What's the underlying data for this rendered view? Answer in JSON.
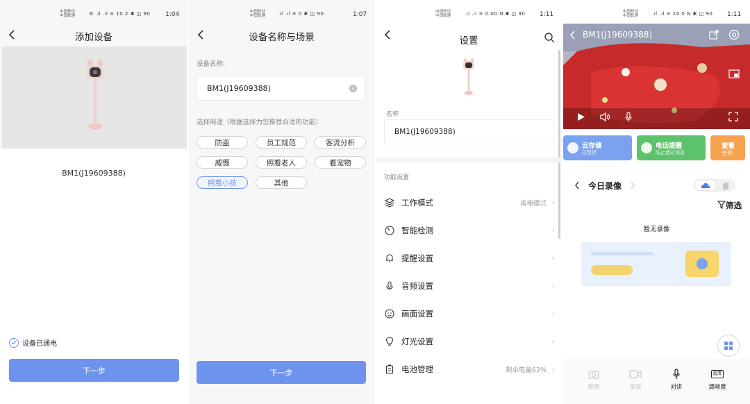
{
  "colors": {
    "primary": "#6e93ef",
    "primary_text": "#ffffff",
    "cloud_card": "#7aa2ef",
    "phone_card": "#5cc26b",
    "more_card": "#f7a24e",
    "video_bg": "#c72a2a"
  },
  "screen1": {
    "status": {
      "carrier": "中国移动\n中国联通",
      "icons": "⚙ .ıl .ıl ≋ 10.2 ✱ ◫ 90",
      "time": "1:04"
    },
    "title": "添加设备",
    "device_name": "BM1(J19609388)",
    "powered_label": "设备已通电",
    "next_button": "下一步"
  },
  "screen2": {
    "status": {
      "carrier": "中国移动\n中国联通",
      "icons": ".ıl .ıl ≋ 0 ✱ ◫ 90",
      "time": "1:07"
    },
    "title": "设备名称与场景",
    "name_label": "设备名称:",
    "name_value": "BM1(J19609388)",
    "usage_label": "选择用途（根据选择为您推荐合适的功能）",
    "chips": [
      "防盗",
      "员工规范",
      "客流分析",
      "威慑",
      "照看老人",
      "看宠物",
      "照看小孩",
      "其他"
    ],
    "selected_chip": "照看小孩",
    "next_button": "下一步"
  },
  "screen3": {
    "status": {
      "carrier": "中国移动\n中国联通",
      "icons": ".ıl .ıl ≋ 0.00 N ✱ ◫ 90",
      "time": "1:11"
    },
    "title": "设置",
    "name_label": "名称",
    "name_value": "BM1(J19609388)",
    "section_label": "功能设置",
    "rows": [
      {
        "label": "工作模式",
        "value": "省电模式",
        "icon": "layers-icon"
      },
      {
        "label": "智能检测",
        "value": "",
        "icon": "detect-icon"
      },
      {
        "label": "提醒设置",
        "value": "",
        "icon": "bell-icon"
      },
      {
        "label": "音频设置",
        "value": "",
        "icon": "mic-icon"
      },
      {
        "label": "画面设置",
        "value": "",
        "icon": "face-icon"
      },
      {
        "label": "灯光设置",
        "value": "",
        "icon": "bulb-icon"
      },
      {
        "label": "电池管理",
        "value": "剩余电量63%",
        "icon": "battery-icon"
      }
    ]
  },
  "screen4": {
    "status": {
      "carrier": "中国移动\n中国联通",
      "icons": ".ıl .ıl ≋ 24.0 N ✱ ◫ 90",
      "time": "1:11"
    },
    "video_title": "BM1(J19609388)",
    "cards": [
      {
        "title": "云存储",
        "subtitle": "已暂停",
        "icon": "cloud-icon"
      },
      {
        "title": "电话提醒",
        "subtitle": "防止错过消息",
        "icon": "phone-icon"
      },
      {
        "title": "查看",
        "subtitle": "全部",
        "icon": ""
      }
    ],
    "recording_label": "今日录像",
    "filter_label": "筛选",
    "empty_label": "暂无录像",
    "tools": [
      {
        "label": "截图",
        "icon": "camera-icon",
        "enabled": false
      },
      {
        "label": "录像",
        "icon": "video-icon",
        "enabled": false
      },
      {
        "label": "对讲",
        "icon": "mic-icon",
        "enabled": true
      },
      {
        "label": "清晰度",
        "icon": "quality-icon",
        "enabled": true
      }
    ],
    "quality_badge": "超清"
  }
}
